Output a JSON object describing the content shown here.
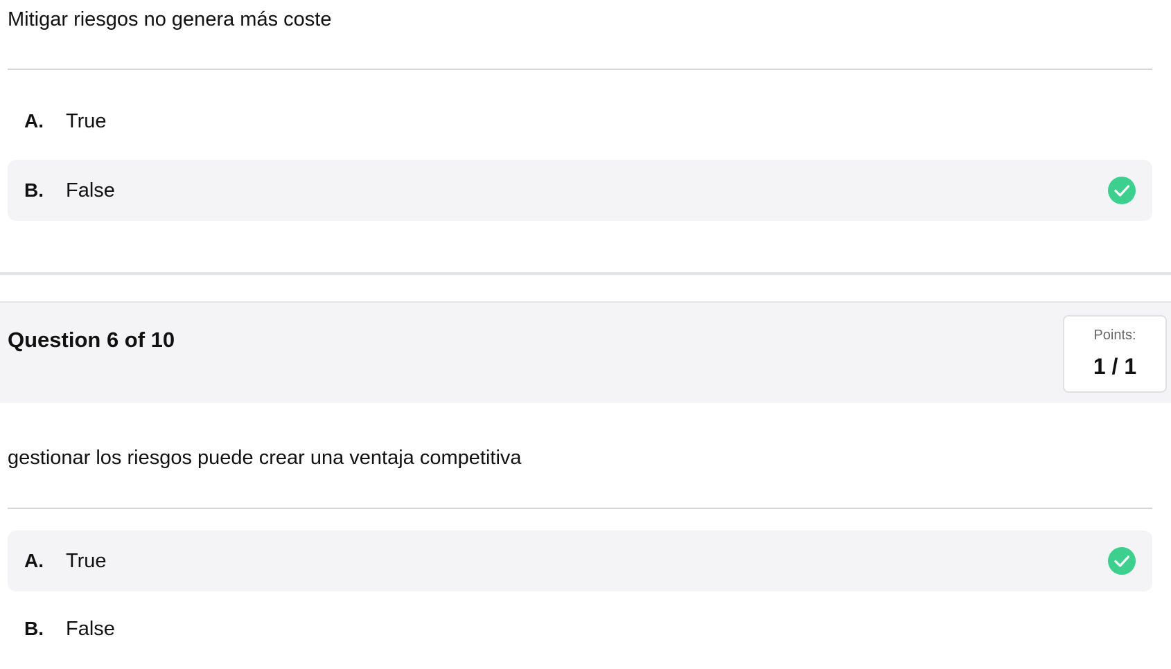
{
  "question5": {
    "text": "Mitigar riesgos no genera más coste",
    "options": [
      {
        "letter": "A.",
        "label": "True",
        "selected": false
      },
      {
        "letter": "B.",
        "label": "False",
        "selected": true
      }
    ]
  },
  "question6": {
    "title": "Question 6 of 10",
    "points_label": "Points:",
    "points_value": "1 / 1",
    "text": "gestionar los riesgos puede crear una ventaja competitiva",
    "options": [
      {
        "letter": "A.",
        "label": "True",
        "selected": true
      },
      {
        "letter": "B.",
        "label": "False",
        "selected": false
      }
    ]
  },
  "icons": {
    "correct": "check-circle-icon"
  },
  "colors": {
    "correct_green": "#3ccf8e",
    "selected_bg": "#f4f4f6",
    "header_bg": "#f4f4f6"
  }
}
